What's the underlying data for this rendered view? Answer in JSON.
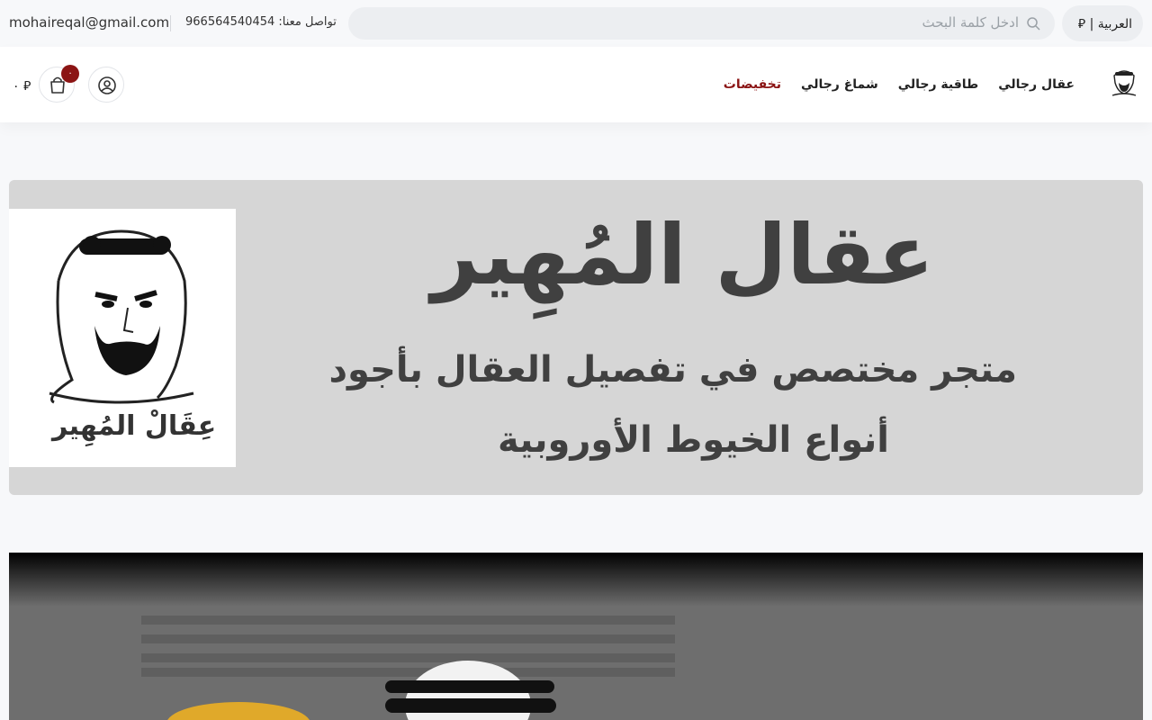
{
  "topbar": {
    "email": "mohaireqal@gmail.com",
    "phone": "تواصل معنا: 966564540454",
    "search_placeholder": "ادخل كلمة البحث",
    "language": "العربية | ⃁"
  },
  "header": {
    "nav": [
      "عقال رجالي",
      "طاقية رجالي",
      "شماغ رجالي",
      "تخفيضات"
    ],
    "price": "٠ ⃁",
    "cart_count": "٠"
  },
  "banner": {
    "title": "عقال المُهِير",
    "line1": "متجر مختصص في تفصيل العقال بأجود",
    "line2": "أنواع الخيوط الأوروبية",
    "logo_caption": "عِقَالْ المُهِير"
  },
  "colors": {
    "accent": "#8b1414",
    "banner_bg": "#d6d6d6"
  }
}
